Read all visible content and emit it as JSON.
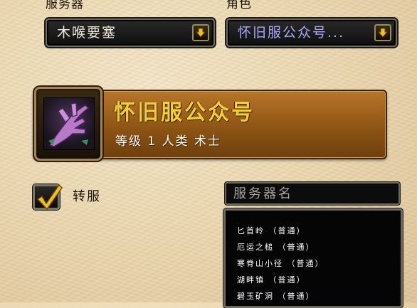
{
  "server_label": "服务器",
  "character_label": "角色",
  "server_dropdown": {
    "value": "木喉要塞"
  },
  "character_dropdown": {
    "value": "怀旧服公众号..."
  },
  "character": {
    "name": "怀旧服公众号",
    "info": "等级 1 人类 术士",
    "portrait_icon": "warlock-purple-hand-icon"
  },
  "transfer": {
    "label": "转服",
    "checked": true
  },
  "server_search": {
    "placeholder": "服务器名"
  },
  "server_list": [
    "匕首岭 （普通）",
    "厄运之槌 （普通）",
    "寒脊山小径 （普通）",
    "湖畔镇 （普通）",
    "碧玉矿洞 （普通）"
  ],
  "colors": {
    "gold_name": "#f4d034",
    "char_dropdown_text": "#a7a7ff",
    "card": "#8a5212"
  }
}
